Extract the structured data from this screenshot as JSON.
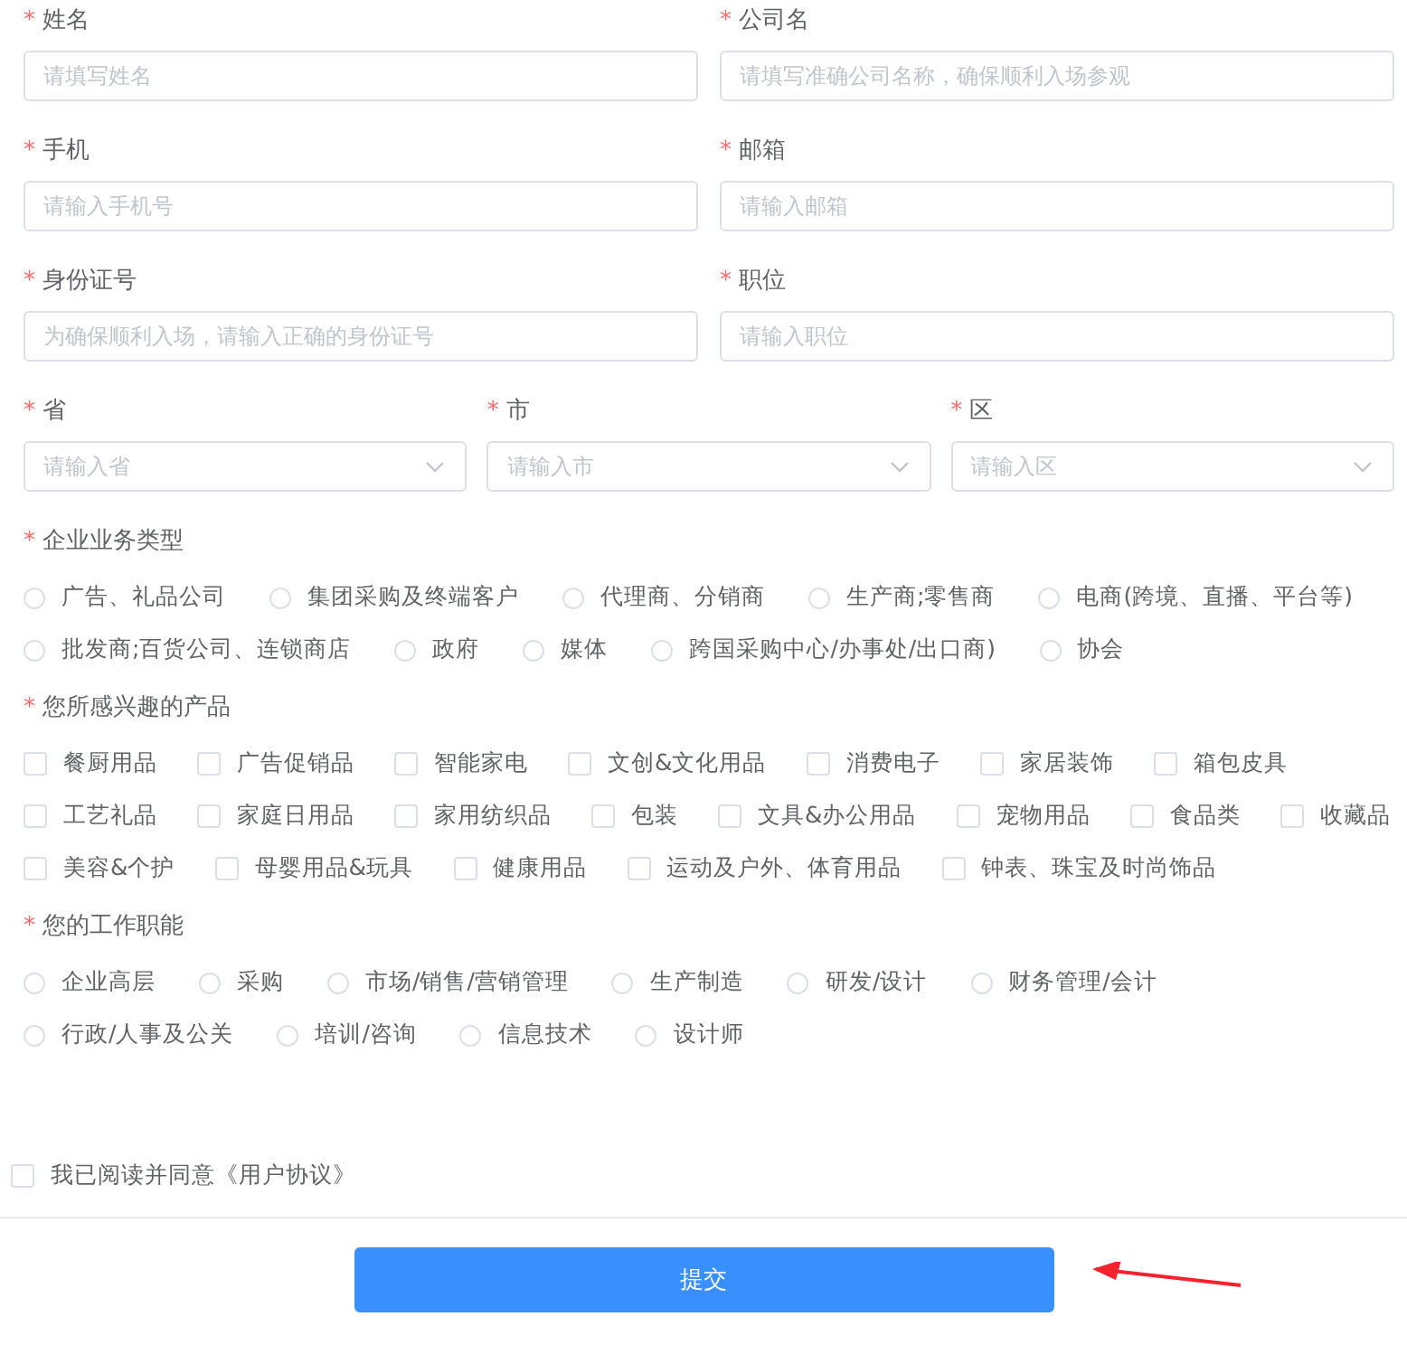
{
  "field_rows": [
    {
      "fields": [
        {
          "mark": "*",
          "label": "姓名",
          "kind": "input",
          "placeholder": "请填写姓名"
        },
        {
          "mark": "*",
          "label": "公司名",
          "kind": "input",
          "placeholder": "请填写准确公司名称，确保顺利入场参观"
        }
      ]
    },
    {
      "fields": [
        {
          "mark": "*",
          "label": "手机",
          "kind": "input",
          "placeholder": "请输入手机号"
        },
        {
          "mark": "*",
          "label": "邮箱",
          "kind": "input",
          "placeholder": "请输入邮箱"
        }
      ]
    },
    {
      "fields": [
        {
          "mark": "*",
          "label": "身份证号",
          "kind": "input",
          "placeholder": "为确保顺利入场，请输入正确的身份证号"
        },
        {
          "mark": "*",
          "label": "职位",
          "kind": "input",
          "placeholder": "请输入职位"
        }
      ]
    },
    {
      "fields": [
        {
          "mark": "*",
          "label": "省",
          "kind": "select",
          "placeholder": "请输入省"
        },
        {
          "mark": "*",
          "label": "市",
          "kind": "select",
          "placeholder": "请输入市"
        },
        {
          "mark": "*",
          "label": "区",
          "kind": "select",
          "placeholder": "请输入区"
        }
      ]
    }
  ],
  "groups": [
    {
      "mark": "*",
      "label": "企业业务类型",
      "kind": "radio",
      "options": [
        {
          "label": "广告、礼品公司",
          "selected": false
        },
        {
          "label": "集团采购及终端客户",
          "selected": false
        },
        {
          "label": "代理商、分销商",
          "selected": false
        },
        {
          "label": "生产商;零售商",
          "selected": false
        },
        {
          "label": "电商(跨境、直播、平台等)",
          "selected": false
        },
        {
          "label": "批发商;百货公司、连锁商店",
          "selected": false
        },
        {
          "label": "政府",
          "selected": false
        },
        {
          "label": "媒体",
          "selected": false
        },
        {
          "label": "跨国采购中心/办事处/出口商)",
          "selected": false
        },
        {
          "label": "协会",
          "selected": false
        }
      ]
    },
    {
      "mark": "*",
      "label": "您所感兴趣的产品",
      "kind": "checkbox",
      "options": [
        {
          "label": "餐厨用品",
          "checked": false
        },
        {
          "label": "广告促销品",
          "checked": false
        },
        {
          "label": "智能家电",
          "checked": false
        },
        {
          "label": "文创&文化用品",
          "checked": false
        },
        {
          "label": "消费电子",
          "checked": false
        },
        {
          "label": "家居装饰",
          "checked": false
        },
        {
          "label": "箱包皮具",
          "checked": false
        },
        {
          "label": "工艺礼品",
          "checked": false
        },
        {
          "label": "家庭日用品",
          "checked": false
        },
        {
          "label": "家用纺织品",
          "checked": false
        },
        {
          "label": "包装",
          "checked": false
        },
        {
          "label": "文具&办公用品",
          "checked": false
        },
        {
          "label": "宠物用品",
          "checked": false
        },
        {
          "label": "食品类",
          "checked": false
        },
        {
          "label": "收藏品",
          "checked": false
        },
        {
          "label": "美容&个护",
          "checked": false
        },
        {
          "label": "母婴用品&玩具",
          "checked": false
        },
        {
          "label": "健康用品",
          "checked": false
        },
        {
          "label": "运动及户外、体育用品",
          "checked": false
        },
        {
          "label": "钟表、珠宝及时尚饰品",
          "checked": false
        }
      ]
    },
    {
      "mark": "*",
      "label": "您的工作职能",
      "kind": "radio",
      "options": [
        {
          "label": "企业高层",
          "selected": false
        },
        {
          "label": "采购",
          "selected": false
        },
        {
          "label": "市场/销售/营销管理",
          "selected": false
        },
        {
          "label": "生产制造",
          "selected": false
        },
        {
          "label": "研发/设计",
          "selected": false
        },
        {
          "label": "财务管理/会计",
          "selected": false
        },
        {
          "label": "行政/人事及公关",
          "selected": false
        },
        {
          "label": "培训/咨询",
          "selected": false
        },
        {
          "label": "信息技术",
          "selected": false
        },
        {
          "label": "设计师",
          "selected": false
        }
      ]
    }
  ],
  "agreement": {
    "label": "我已阅读并同意《用户协议》",
    "checked": false
  },
  "submit": "提交"
}
